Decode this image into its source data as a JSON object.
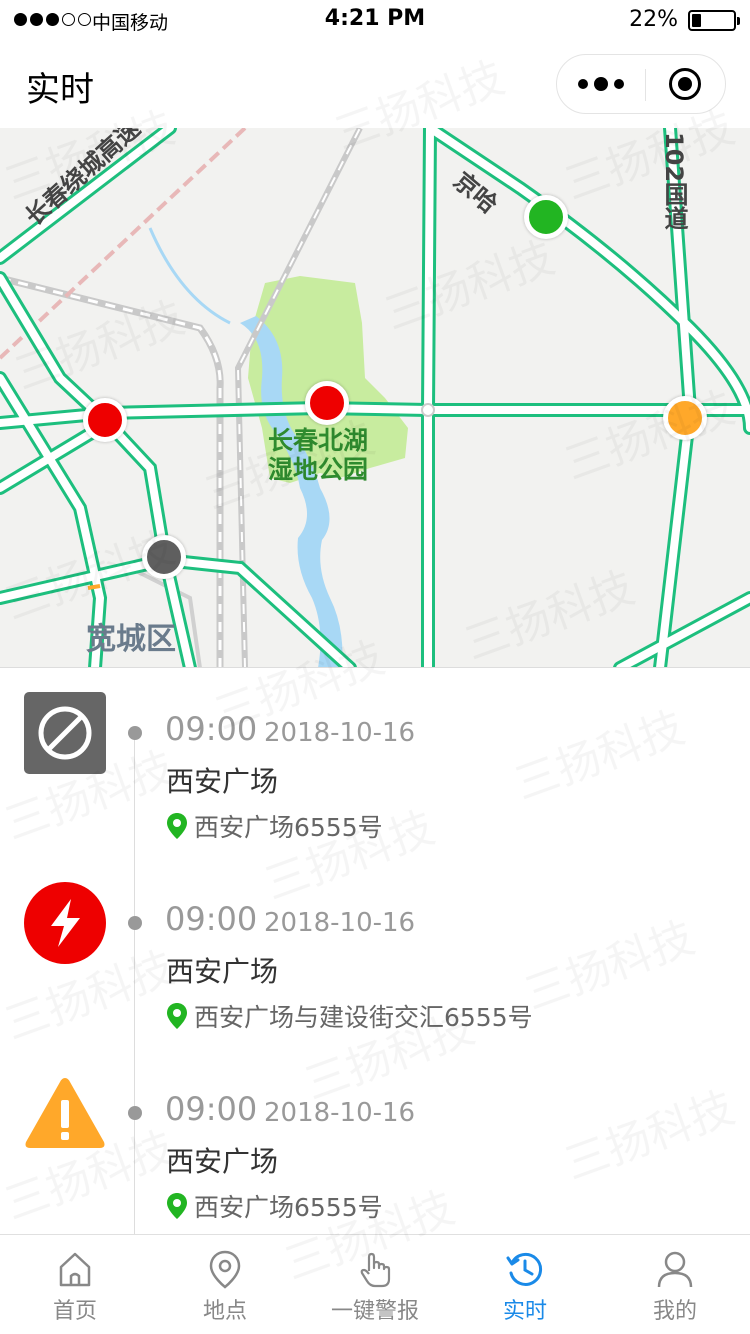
{
  "status_bar": {
    "carrier": "中国移动",
    "time": "4:21 PM",
    "battery_percent_text": "22%",
    "battery_level": 0.22,
    "signal_bars": 3,
    "signal_total": 5
  },
  "nav": {
    "title": "实时",
    "more_icon": "more-dots-icon",
    "close_icon": "target-circle-icon"
  },
  "map": {
    "park_label_line1": "长春北湖",
    "park_label_line2": "湿地公园",
    "district_label": "宽城区",
    "road_label_1": "长春绕城高速",
    "road_label_2": "京哈",
    "road_label_3": "102国道",
    "markers": [
      {
        "name": "marker-green",
        "color": "#22b522"
      },
      {
        "name": "marker-red-left",
        "color": "#ee0000"
      },
      {
        "name": "marker-red-center",
        "color": "#ee0000"
      },
      {
        "name": "marker-orange",
        "color": "#ffa82a"
      },
      {
        "name": "marker-gray",
        "color": "#5f5f5f"
      }
    ]
  },
  "watermark": "三扬科技",
  "events": [
    {
      "icon": "prohibited-icon",
      "icon_color": "#666666",
      "time": "09:00",
      "date": "2018-10-16",
      "title": "西安广场",
      "address": "西安广场6555号"
    },
    {
      "icon": "lightning-icon",
      "icon_color": "#ee0000",
      "time": "09:00",
      "date": "2018-10-16",
      "title": "西安广场",
      "address": "西安广场与建设街交汇6555号"
    },
    {
      "icon": "warning-triangle-icon",
      "icon_color": "#ffa82a",
      "time": "09:00",
      "date": "2018-10-16",
      "title": "西安广场",
      "address": "西安广场6555号"
    }
  ],
  "tabs": [
    {
      "label": "首页",
      "icon": "home-icon",
      "active": false
    },
    {
      "label": "地点",
      "icon": "location-pin-icon",
      "active": false
    },
    {
      "label": "一键警报",
      "icon": "hand-tap-icon",
      "active": false
    },
    {
      "label": "实时",
      "icon": "clock-history-icon",
      "active": true
    },
    {
      "label": "我的",
      "icon": "user-icon",
      "active": false
    }
  ],
  "colors": {
    "accent": "#1a8ae8",
    "road": "#1dbf7e",
    "park": "#c8ec9f",
    "water": "#a8d8f5",
    "pin": "#22b522"
  }
}
